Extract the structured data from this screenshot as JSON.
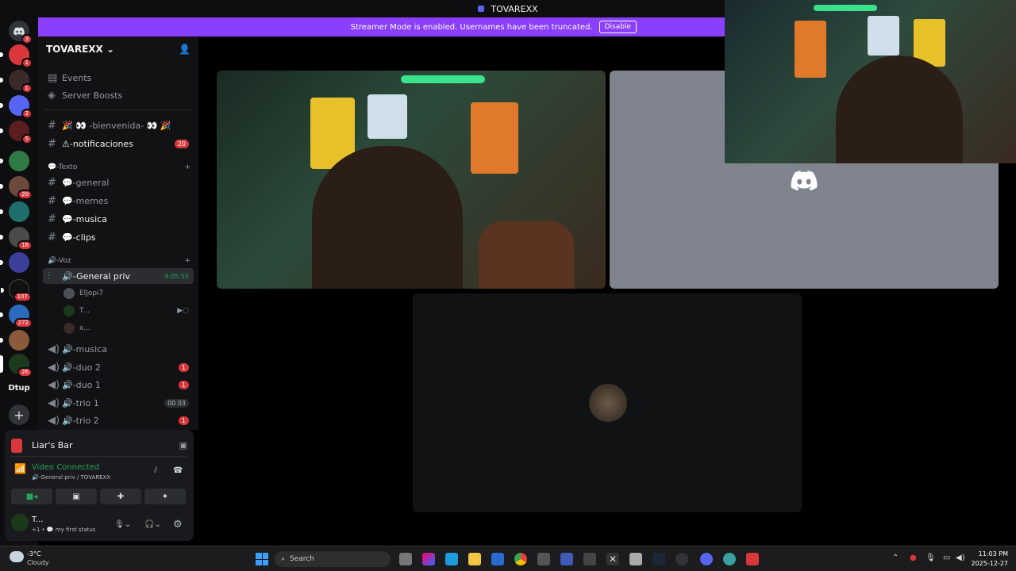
{
  "window": {
    "title": "TOVAREXX"
  },
  "banner": {
    "text": "Streamer Mode is enabled. Usernames have been truncated.",
    "button": "Disable"
  },
  "guilds": {
    "badges": [
      "3",
      "1",
      "1",
      "2",
      "5",
      "20",
      "18",
      "107",
      "272",
      "26"
    ],
    "dtup_label": "Dtup",
    "add_label": "+"
  },
  "server": {
    "name": "TOVAREXX",
    "events": "Events",
    "boosts": "Server Boosts",
    "channels_top": [
      {
        "name": "🎉 👀 -bienvenida- 👀 🎉",
        "badge": ""
      },
      {
        "name": "⚠-notificaciones",
        "badge": "20"
      }
    ],
    "text_category": "💬-Texto",
    "text_channels": [
      "💬-general",
      "💬-memes",
      "💬-musica",
      "💬-clips"
    ],
    "voice_category": "🔊-Voz",
    "active_voice": {
      "name": "🔊-General priv",
      "time": "4:05:55"
    },
    "voice_members": [
      "ElJopi7",
      "T...",
      "x..."
    ],
    "voice_channels": [
      {
        "name": "🔊-musica",
        "badge": ""
      },
      {
        "name": "🔊-duo 2",
        "badge": "1"
      },
      {
        "name": "🔊-duo 1",
        "badge": "1"
      },
      {
        "name": "🔊-trio 1",
        "badge": "00 03"
      },
      {
        "name": "🔊-trio 2",
        "badge": "1"
      }
    ]
  },
  "panel": {
    "activity": "Liar's Bar",
    "status": "Video Connected",
    "location": "🔊-General priv / TOVAREXX",
    "user_name": "T...",
    "user_status": "+1 • 💬 my first status"
  },
  "taskbar": {
    "weather_temp": "-3°C",
    "weather_desc": "Cloudy",
    "search": "Search",
    "time": "11:03 PM",
    "date": "2025-12-27"
  },
  "colors": {
    "accent": "#5865f2",
    "banner": "#8a3ffc",
    "badge": "#da373c",
    "green": "#23a55a"
  }
}
